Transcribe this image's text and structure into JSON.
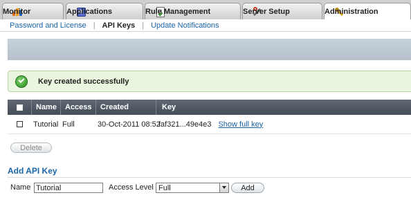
{
  "tabs": [
    {
      "label": "Monitor",
      "icon": "bar-chart-icon"
    },
    {
      "label": "Applications",
      "icon": "applications-icon"
    },
    {
      "label": "Rule Management",
      "icon": "rule-management-icon"
    },
    {
      "label": "Server Setup",
      "icon": "wrench-icon"
    },
    {
      "label": "Administration",
      "icon": "administration-icon",
      "active": true
    }
  ],
  "subnav": {
    "password": "Password and License",
    "apikeys": "API Keys",
    "notifications": "Update Notifications",
    "separator": "|"
  },
  "message": {
    "text": "Key created successfully"
  },
  "table": {
    "columns": [
      "Name",
      "Access",
      "Created",
      "Key"
    ],
    "rows": [
      {
        "name": "Tutorial",
        "access": "Full",
        "created": "30-Oct-2011 08:52",
        "key": "faf321...49e4e3",
        "link": "Show full key"
      }
    ]
  },
  "buttons": {
    "delete": "Delete",
    "add": "Add"
  },
  "add_form": {
    "title": "Add API Key",
    "name_label": "Name",
    "name_value": "Tutorial",
    "access_label": "Access Level",
    "access_value": "Full"
  },
  "colors": {
    "link": "#1a64a8",
    "success_bg": "#eaf5df",
    "header_bg": "#4f5863"
  }
}
